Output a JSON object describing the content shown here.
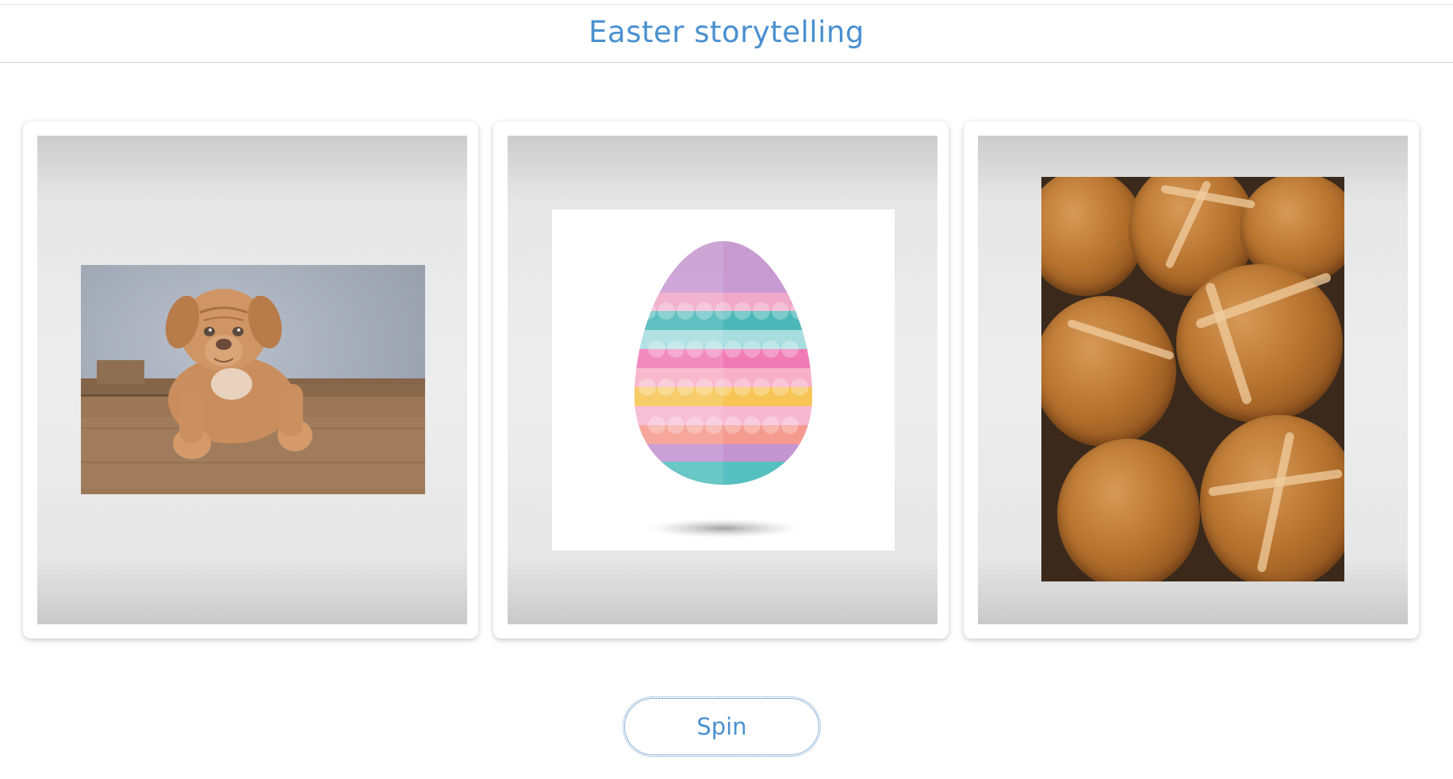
{
  "header": {
    "title": "Easter storytelling"
  },
  "slots": [
    {
      "image": "puppy-in-wooden-crate"
    },
    {
      "image": "pastel-patterned-easter-egg"
    },
    {
      "image": "hot-cross-buns"
    }
  ],
  "controls": {
    "spin_label": "Spin"
  },
  "colors": {
    "accent": "#4a90d0",
    "card_background": "#ffffff",
    "slot_background": "#ededed"
  }
}
